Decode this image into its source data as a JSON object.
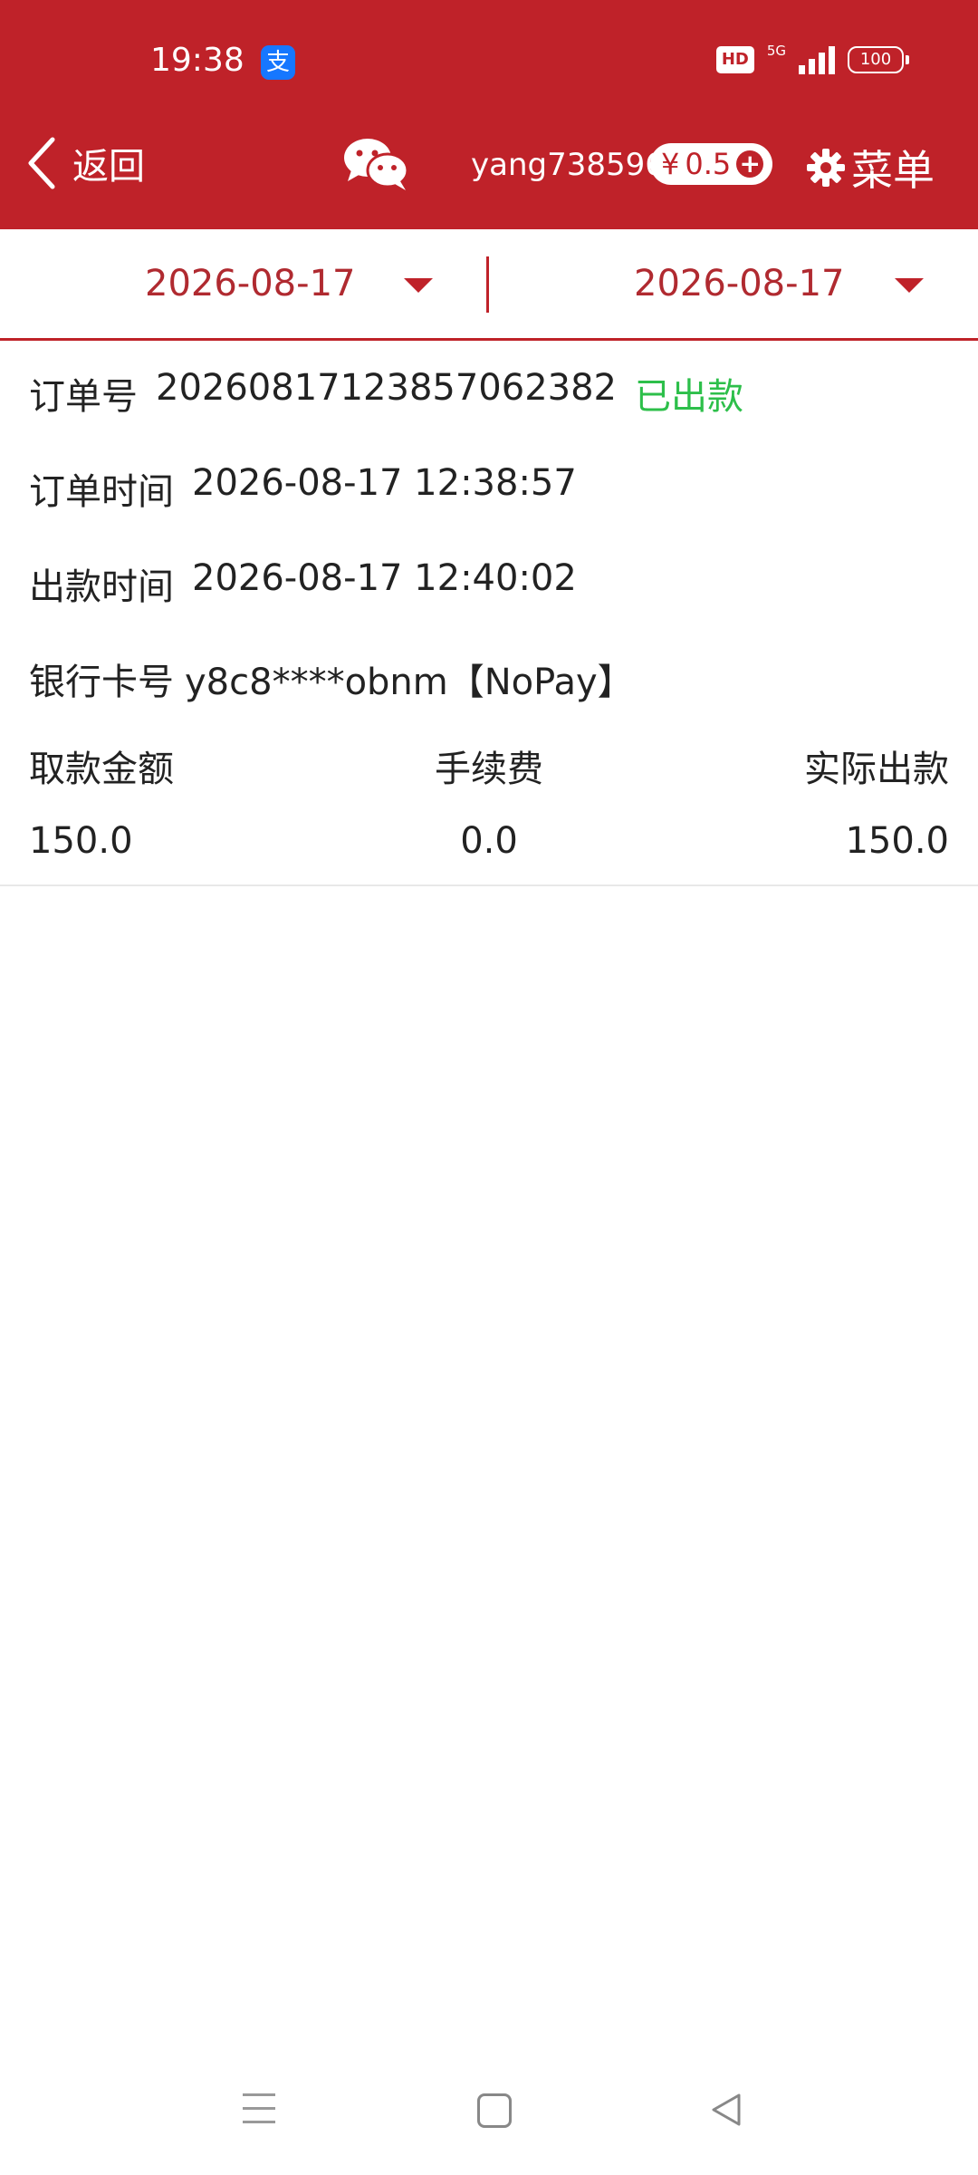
{
  "status_bar": {
    "time": "19:38",
    "app_icon": "alipay-icon",
    "app_icon_glyph": "支",
    "hd": "HD",
    "network": "5G",
    "battery": "100"
  },
  "header": {
    "back_label": "返回",
    "username": "yang738596",
    "balance_symbol": "¥",
    "balance_value": "0.5",
    "balance_add": "+",
    "menu_label": "菜单",
    "wechat_icon": "wechat-icon",
    "menu_icon": "gear-icon",
    "back_icon": "chevron-left-icon"
  },
  "date_filter": {
    "start_date": "2026-08-17",
    "end_date": "2026-08-17"
  },
  "order": {
    "order_no_label": "订单号",
    "order_no": "20260817123857062382",
    "status": "已出款",
    "order_time_label": "订单时间",
    "order_time": "2026-08-17 12:38:57",
    "payout_time_label": "出款时间",
    "payout_time": "2026-08-17 12:40:02",
    "bank_card_label": "银行卡号",
    "bank_card": "y8c8****obnm【NoPay】",
    "columns": [
      "取款金额",
      "手续费",
      "实际出款"
    ],
    "values": [
      "150.0",
      "0.0",
      "150.0"
    ]
  },
  "colors": {
    "brand": "#bf2229",
    "status_success": "#2dbf4a"
  }
}
